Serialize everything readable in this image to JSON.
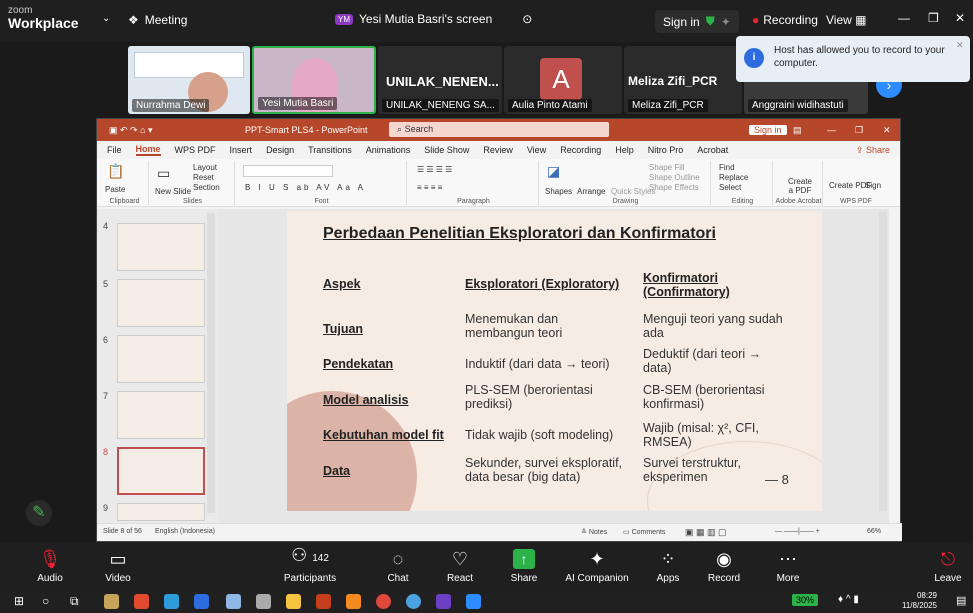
{
  "zoom": {
    "app_small": "zoom",
    "app_big": "Workplace",
    "meeting_label": "Meeting",
    "screen_label": "Yesi Mutia Basri's screen",
    "screen_initials": "YM",
    "sign_in": "Sign in",
    "recording_label": "Recording",
    "view_label": "View",
    "notification": "Host has allowed you to record to your computer."
  },
  "participants": [
    {
      "name": "Nurrahma Dewi"
    },
    {
      "name": "Yesi Mutia Basri"
    },
    {
      "name": "UNILAK_NENENG SA...",
      "tile_title": "UNILAK_NENEN..."
    },
    {
      "name": "Aulia Pinto Atami",
      "initial": "A"
    },
    {
      "name": "Meliza Zifi_PCR",
      "tile_title": "Meliza Zifi_PCR"
    },
    {
      "name": "Anggraini widihastuti"
    }
  ],
  "ppt": {
    "title": "PPT-Smart PLS4 - PowerPoint",
    "search": "Search",
    "sign_in": "Sign in",
    "menu": [
      "File",
      "Home",
      "WPS PDF",
      "Insert",
      "Design",
      "Transitions",
      "Animations",
      "Slide Show",
      "Review",
      "View",
      "Recording",
      "Help",
      "Nitro Pro",
      "Acrobat"
    ],
    "share": "Share",
    "ribbon": {
      "clipboard": "Clipboard",
      "slides": "Slides",
      "font": "Font",
      "paragraph": "Paragraph",
      "drawing": "Drawing",
      "editing": "Editing",
      "adobe": "Adobe Acrobat",
      "wps": "WPS PDF",
      "paste": "Paste",
      "new_slide": "New Slide",
      "layout": "Layout",
      "reset": "Reset",
      "section": "Section",
      "shapes": "Shapes",
      "arrange": "Arrange",
      "quick_styles": "Quick Styles",
      "shape_fill": "Shape Fill",
      "shape_outline": "Shape Outline",
      "shape_effects": "Shape Effects",
      "find": "Find",
      "replace": "Replace",
      "select": "Select",
      "create_pdf": "Create a PDF",
      "create_sign": "Create PDF",
      "sign": "Sign"
    },
    "thumb_numbers": [
      "4",
      "5",
      "6",
      "7",
      "8",
      "9"
    ],
    "status_slide": "Slide 8 of 56",
    "status_lang": "English (Indonesia)",
    "notes": "Notes",
    "comments": "Comments",
    "zoom": "66%"
  },
  "slide": {
    "title": "Perbedaan Penelitian Eksploratori dan Konfirmatori",
    "headers": [
      "Aspek",
      "Eksploratori (Exploratory)",
      "Konfirmatori (Confirmatory)"
    ],
    "rows": [
      {
        "aspect": "Tujuan",
        "explor": "Menemukan dan membangun teori",
        "confirm": "Menguji teori yang sudah ada"
      },
      {
        "aspect": "Pendekatan",
        "explor": "Induktif (dari data → teori)",
        "confirm": "Deduktif (dari teori → data)"
      },
      {
        "aspect": "Model analisis",
        "explor": "PLS-SEM (berorientasi prediksi)",
        "confirm": "CB-SEM (berorientasi konfirmasi)"
      },
      {
        "aspect": "Kebutuhan model fit",
        "explor": "Tidak wajib (soft modeling)",
        "confirm": "Wajib (misal: χ², CFI, RMSEA)"
      },
      {
        "aspect": "Data",
        "explor": "Sekunder, survei eksploratif, data besar (big data)",
        "confirm": "Survei terstruktur, eksperimen"
      }
    ],
    "page_number": "8"
  },
  "toolbar": {
    "audio": "Audio",
    "video": "Video",
    "participants": "Participants",
    "participants_count": "142",
    "chat": "Chat",
    "react": "React",
    "share": "Share",
    "ai": "AI Companion",
    "apps": "Apps",
    "record": "Record",
    "more": "More",
    "leave": "Leave"
  },
  "taskbar": {
    "battery": "30%",
    "time": "08:29",
    "date": "11/8/2025"
  }
}
